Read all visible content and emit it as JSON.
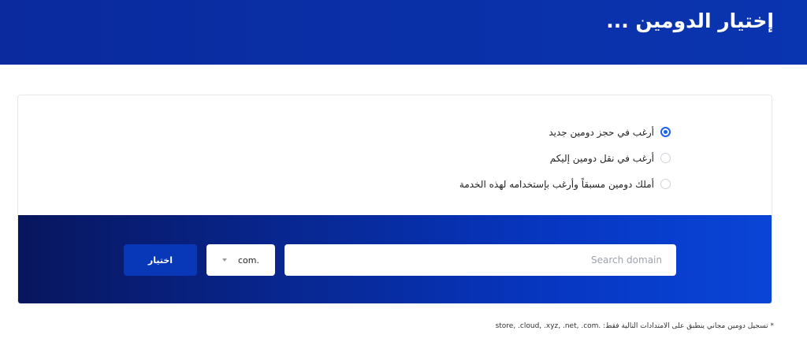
{
  "header": {
    "title": "إختيار الدومين ..."
  },
  "domain_options": [
    {
      "label": "أرغب في حجز دومين جديد",
      "checked": true
    },
    {
      "label": "أرغب في نقل دومين إليكم",
      "checked": false
    },
    {
      "label": "أملك دومين مسبقاً وأرغب بإستخدامه لهذه الخدمة",
      "checked": false
    }
  ],
  "search": {
    "placeholder": "Search domain",
    "value": ""
  },
  "tld_select": {
    "selected": "com."
  },
  "button": {
    "label": "اختيار"
  },
  "footnote": {
    "text": "* تسجيل دومين مجاني ينطبق على الامتدادات التالية فقط: .store, .cloud, .xyz, .net, .com"
  },
  "colors": {
    "primary_blue": "#0a35b0",
    "selected_radio": "#1e63e9",
    "search_band_dark": "#08165e",
    "search_band_light": "#0a45d7"
  },
  "icons": {
    "radio_selected": "radio-checked-icon",
    "radio_unselected": "radio-unchecked-icon",
    "dropdown": "chevron-down-icon"
  }
}
